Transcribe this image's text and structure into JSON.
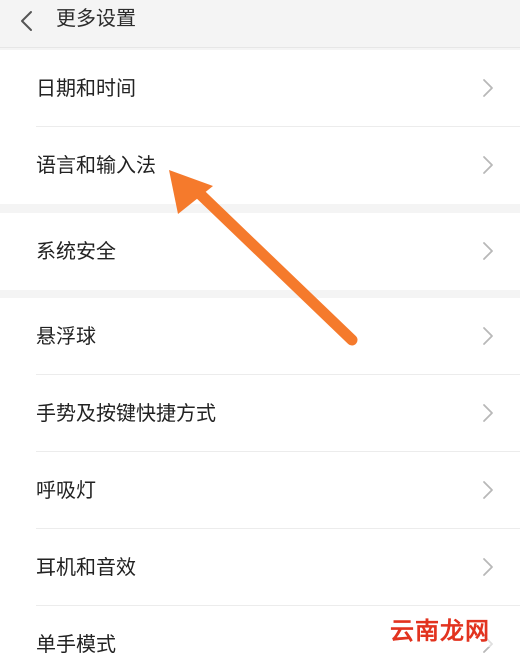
{
  "header": {
    "title": "更多设置",
    "back_icon": "chevron-left-icon"
  },
  "groups": [
    {
      "items": [
        {
          "label": "日期和时间"
        },
        {
          "label": "语言和输入法"
        }
      ]
    },
    {
      "items": [
        {
          "label": "系统安全"
        }
      ]
    },
    {
      "items": [
        {
          "label": "悬浮球"
        },
        {
          "label": "手势及按键快捷方式"
        },
        {
          "label": "呼吸灯"
        },
        {
          "label": "耳机和音效"
        },
        {
          "label": "单手模式"
        }
      ]
    }
  ],
  "watermark": {
    "text": "云南龙网"
  },
  "colors": {
    "annotation_arrow": "#f57a2c",
    "watermark": "#e2331f",
    "chevron": "#b8b8b8"
  }
}
